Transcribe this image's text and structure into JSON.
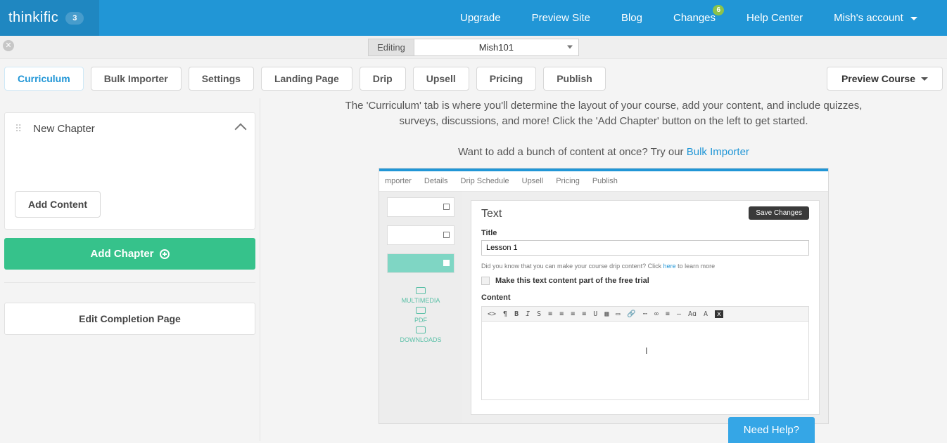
{
  "top": {
    "brand": "thinkific",
    "brandBadge": "3",
    "items": {
      "upgrade": "Upgrade",
      "preview": "Preview Site",
      "blog": "Blog",
      "changes": "Changes",
      "changesBadge": "6",
      "help": "Help Center",
      "account": "Mish's account"
    }
  },
  "editing": {
    "label": "Editing",
    "course": "Mish101"
  },
  "tabs": {
    "curriculum": "Curriculum",
    "bulk": "Bulk Importer",
    "settings": "Settings",
    "landing": "Landing Page",
    "drip": "Drip",
    "upsell": "Upsell",
    "pricing": "Pricing",
    "publish": "Publish",
    "preview": "Preview Course"
  },
  "sidebar": {
    "chapterTitle": "New Chapter",
    "addContent": "Add Content",
    "addChapter": "Add Chapter",
    "editCompletion": "Edit Completion Page"
  },
  "main": {
    "p1": "The 'Curriculum' tab is where you'll determine the layout of your course, add your content, and include quizzes, surveys, discussions, and more! Click the 'Add Chapter' button on the left to get started.",
    "p2a": "Want to add a bunch of content at once? Try our ",
    "p2link": "Bulk Importer"
  },
  "shot": {
    "tabs": [
      "mporter",
      "Details",
      "Drip Schedule",
      "Upsell",
      "Pricing",
      "Publish"
    ],
    "mini": [
      "MULTIMEDIA",
      "PDF",
      "DOWNLOADS"
    ],
    "panelTitle": "Text",
    "save": "Save Changes",
    "titleLbl": "Title",
    "titleVal": "Lesson 1",
    "hint1": "Did you know that you can make your course drip content? Click ",
    "hintLink": "here",
    "hint2": " to learn more",
    "chk": "Make this text content part of the free trial",
    "contentLbl": "Content"
  },
  "needHelp": "Need Help?"
}
